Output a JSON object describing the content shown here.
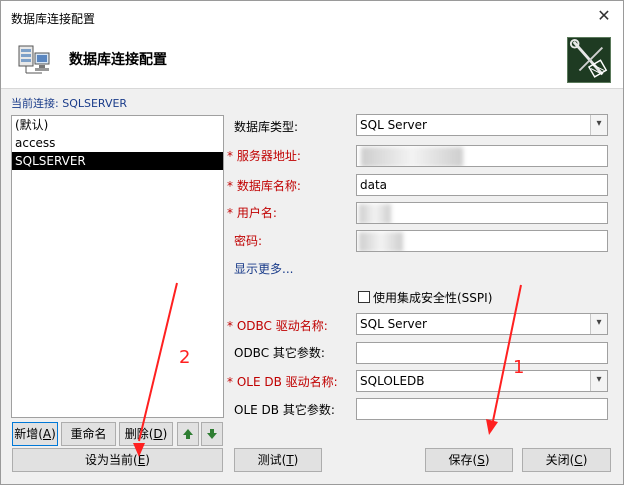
{
  "window": {
    "title": "数据库连接配置",
    "close_icon": "✕"
  },
  "header": {
    "title": "数据库连接配置"
  },
  "current": {
    "label": "当前连接:",
    "value": "SQLSERVER"
  },
  "connections": [
    "(默认)",
    "access",
    "SQLSERVER"
  ],
  "left_buttons": {
    "add": "新增(",
    "add_key": "A",
    "add_end": ")",
    "rename": "重命名(",
    "rename_key": "R",
    "rename_end": ")",
    "delete": "删除(",
    "delete_key": "D",
    "delete_end": ")",
    "set_current": "设为当前(",
    "set_current_key": "E",
    "set_current_end": ")"
  },
  "form": {
    "db_type_label": "数据库类型:",
    "db_type_value": "SQL Server",
    "server_label": "* 服务器地址:",
    "dbname_label": "* 数据库名称:",
    "dbname_value": "data",
    "user_label": "* 用户名:",
    "pwd_label": "密码:",
    "show_more": "显示更多...",
    "sspi_label": "使用集成安全性(SSPI)",
    "odbc_driver_label": "* ODBC 驱动名称:",
    "odbc_driver_value": "SQL Server",
    "odbc_other_label": "ODBC 其它参数:",
    "oledb_driver_label": "* OLE DB 驱动名称:",
    "oledb_driver_value": "SQLOLEDB",
    "oledb_other_label": "OLE DB 其它参数:"
  },
  "bottom_buttons": {
    "test": "测试(",
    "test_key": "T",
    "test_end": ")",
    "save": "保存(",
    "save_key": "S",
    "save_end": ")",
    "close": "关闭(",
    "close_key": "C",
    "close_end": ")"
  },
  "annotations": {
    "one": "1",
    "two": "2"
  },
  "colors": {
    "required_red": "#c00000",
    "link_blue": "#1a3c8a",
    "selection": "#000000",
    "annotation": "#ff2020"
  }
}
